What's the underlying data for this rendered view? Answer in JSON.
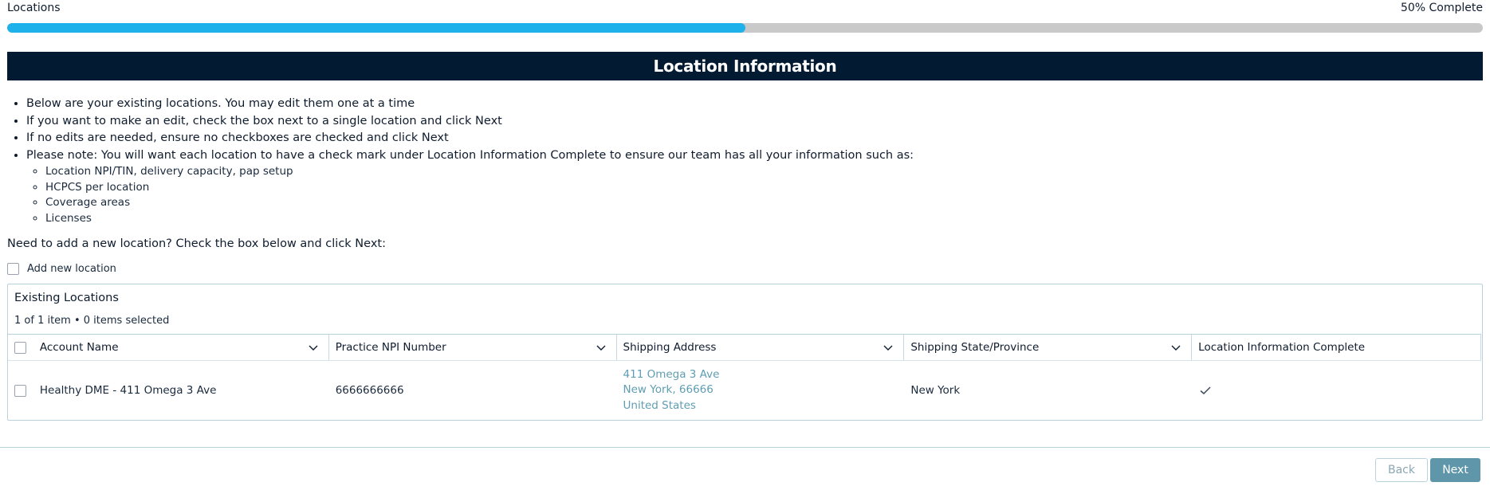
{
  "progress": {
    "step_label": "Locations",
    "status_text": "50% Complete",
    "fraction": 0.5,
    "fill_color": "#1eb1ea",
    "track_color": "#c9c9c9"
  },
  "section": {
    "title": "Location Information",
    "banner_color": "#031a33"
  },
  "instructions": {
    "items": [
      "Below are your existing locations. You may edit them one at a time",
      "If you want to make an edit, check the box next to a single location and click Next",
      "If no edits are needed, ensure no checkboxes are checked and click Next",
      "Please note: You will want each location to have a check mark under Location Information Complete to ensure our team has all your information such as:"
    ],
    "sub_items": [
      "Location NPI/TIN, delivery capacity, pap setup",
      "HCPCS per location",
      "Coverage areas",
      "Licenses"
    ]
  },
  "add_location": {
    "prompt": "Need to add a new location? Check the box below and click Next:",
    "checkbox_label": "Add new location",
    "checked": false
  },
  "existing_locations": {
    "title": "Existing Locations",
    "count_text": "1 of 1 item • 0 items selected",
    "columns": [
      "Account Name",
      "Practice NPI Number",
      "Shipping Address",
      "Shipping State/Province",
      "Location Information Complete"
    ],
    "rows": [
      {
        "account_name": "Healthy DME - 411 Omega 3 Ave",
        "npi": "6666666666",
        "address_line1": "411 Omega 3 Ave",
        "address_line2": "New York, 66666",
        "address_line3": "United States",
        "state": "New York",
        "complete_icon": "check-icon"
      }
    ],
    "link_color": "#5f9db2"
  },
  "footer": {
    "back_label": "Back",
    "next_label": "Next",
    "next_color": "#5f96aa"
  }
}
